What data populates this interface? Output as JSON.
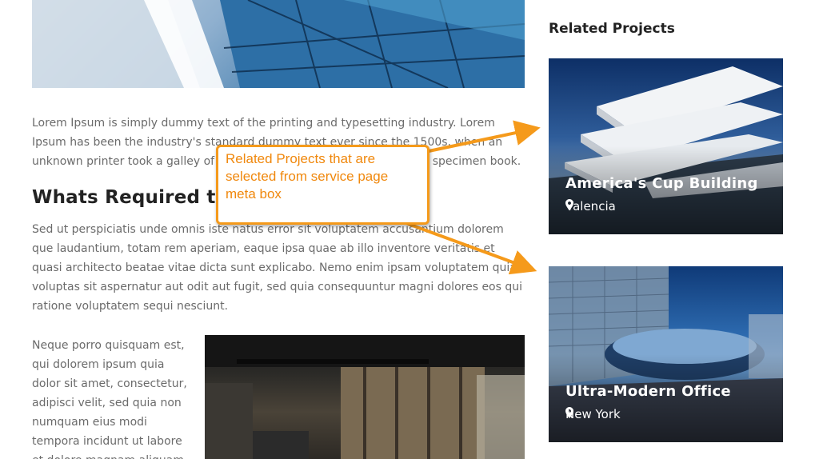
{
  "article": {
    "paragraph_1": "Lorem Ipsum is simply dummy text of the printing and typesetting industry. Lorem Ipsum has been the industry's standard dummy text ever since the 1500s, when an unknown printer took a galley of type and scrambled it to make a type specimen book.",
    "heading": "Whats Required to Start",
    "paragraph_2": "Sed ut perspiciatis unde omnis iste natus error sit voluptatem accusantium dolorem que laudantium, totam rem aperiam, eaque ipsa quae ab illo inventore veritatis et quasi architecto beatae vitae dicta sunt explicabo. Nemo enim ipsam voluptatem quia voluptas sit aspernatur aut odit aut fugit, sed quia consequuntur magni dolores eos qui ratione voluptatem sequi nesciunt.",
    "paragraph_3": "Neque porro quisquam est, qui dolorem ipsum quia dolor sit amet, consectetur, adipisci velit, sed quia non numquam eius modi tempora incidunt ut labore et dolore magnam aliquam"
  },
  "sidebar": {
    "title": "Related Projects",
    "projects": [
      {
        "title": "America's Cup Building",
        "location": "Valencia",
        "icon": "map-pin-icon"
      },
      {
        "title": "Ultra-Modern Office",
        "location": "New York",
        "icon": "map-pin-icon"
      }
    ]
  },
  "annotation": {
    "text": "Related Projects that are selected from service page meta box",
    "color": "#f59a1b"
  }
}
